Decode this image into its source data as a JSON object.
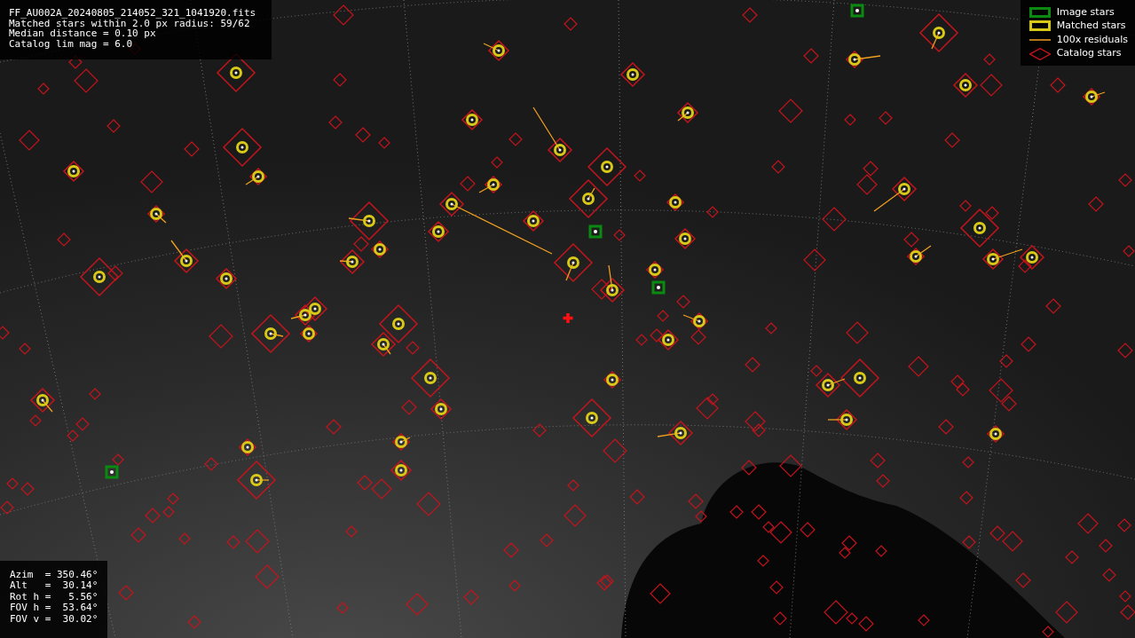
{
  "file_info": [
    "FF_AU002A_20240805_214052_321_1041920.fits",
    "Matched stars within 2.0 px radius: 59/62",
    "Median distance = 0.10 px",
    "Catalog lim mag = 6.0"
  ],
  "legend": [
    {
      "kind": "image",
      "label": "Image stars"
    },
    {
      "kind": "matched",
      "label": "Matched stars"
    },
    {
      "kind": "residual",
      "label": "100x residuals"
    },
    {
      "kind": "catalog",
      "label": "Catalog stars"
    }
  ],
  "pointing": [
    "Azim  = 350.46°",
    "Alt   =  30.14°",
    "Rot h =   5.56°",
    "FOV h =  53.64°",
    "FOV v =  30.02°"
  ]
}
